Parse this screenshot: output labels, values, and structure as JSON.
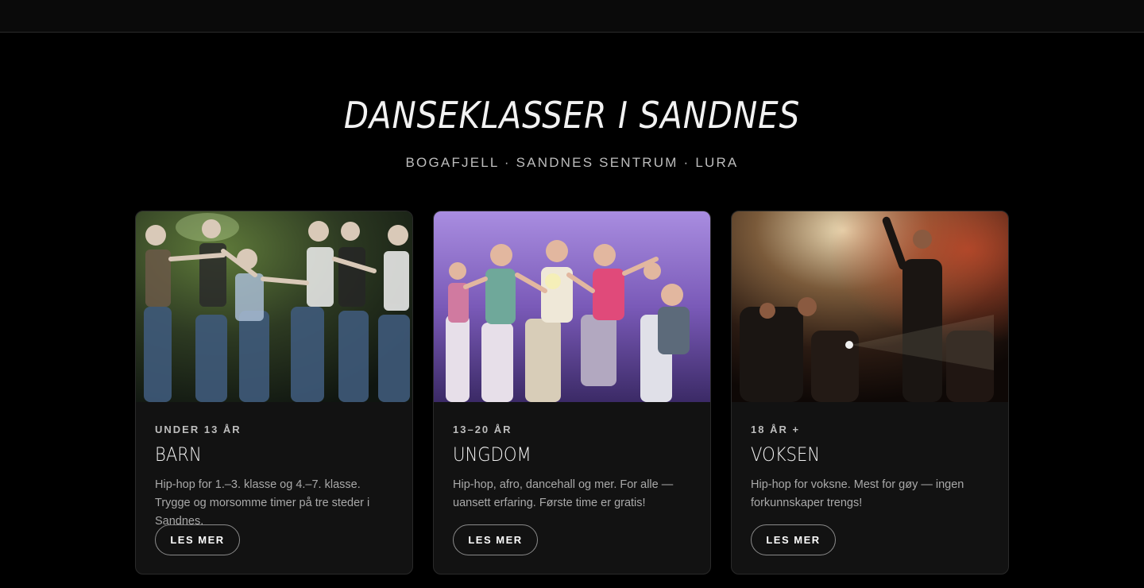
{
  "header": {
    "title": "DANSEKLASSER I SANDNES",
    "subtitle": "BOGAFJELL · SANDNES SENTRUM · LURA"
  },
  "cards": [
    {
      "age": "UNDER 13 ÅR",
      "title": "BARN",
      "description": "Hip-hop for 1.–3. klasse og 4.–7. klasse. Trygge og morsomme timer på tre steder i Sandnes.",
      "button": "LES MER",
      "image": "dance-group-kids-photo"
    },
    {
      "age": "13–20 ÅR",
      "title": "UNGDOM",
      "description": "Hip-hop, afro, dancehall og mer. For alle — uansett erfaring. Første time er gratis!",
      "button": "LES MER",
      "image": "dance-group-youth-photo"
    },
    {
      "age": "18 ÅR +",
      "title": "VOKSEN",
      "description": "Hip-hop for voksne. Mest for gøy — ingen forkunnskaper trengs!",
      "button": "LES MER",
      "image": "dance-adults-stage-photo"
    }
  ],
  "colors": {
    "background": "#000000",
    "card": "#121212",
    "border": "#2a2a2a",
    "text_muted": "#a9a9a9"
  }
}
